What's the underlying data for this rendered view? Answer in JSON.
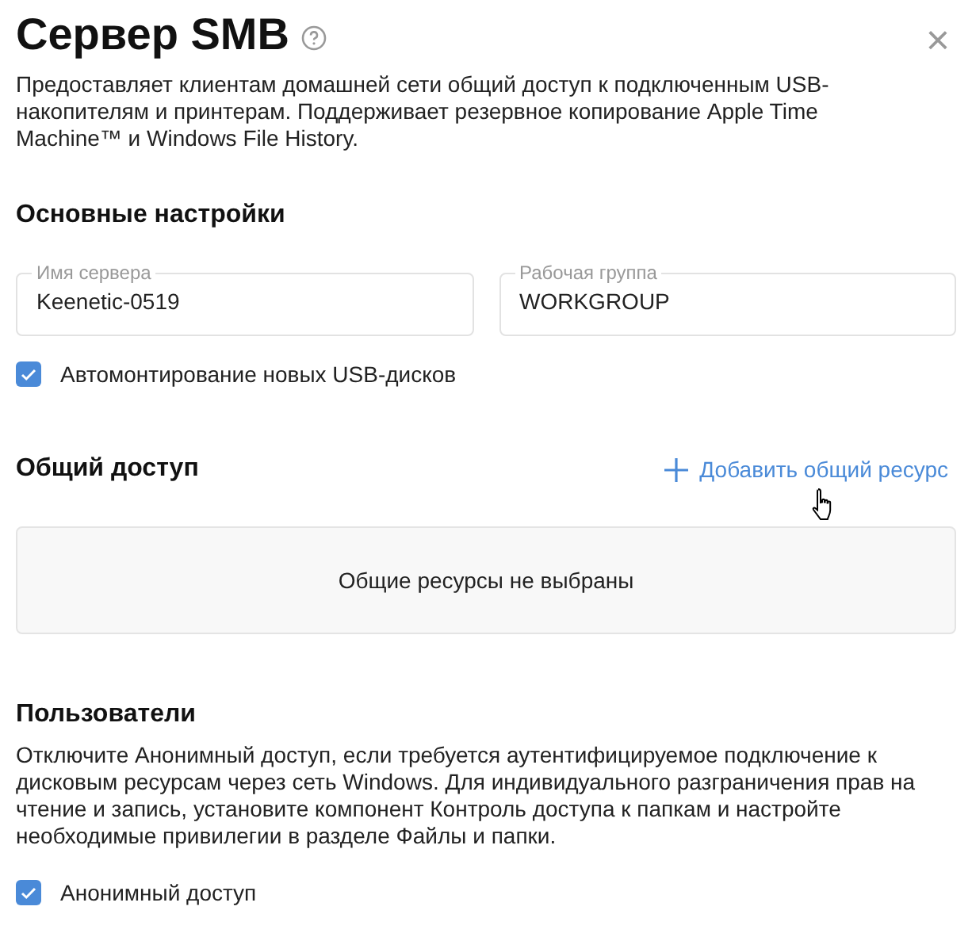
{
  "header": {
    "title": "Сервер SMB",
    "close": "×"
  },
  "description": "Предоставляет клиентам домашней сети общий доступ к подключенным USB-накопителям и принтерам. Поддерживает резервное копирование Apple Time Machine™ и Windows File History.",
  "basic_settings": {
    "heading": "Основные настройки",
    "fields": [
      {
        "label": "Имя сервера",
        "value": "Keenetic-0519"
      },
      {
        "label": "Рабочая группа",
        "value": "WORKGROUP"
      }
    ],
    "automount": {
      "label": "Автомонтирование новых USB-дисков",
      "checked": true
    }
  },
  "sharing": {
    "heading": "Общий доступ",
    "add_link": "Добавить общий ресурс",
    "empty_message": "Общие ресурсы не выбраны"
  },
  "users": {
    "heading": "Пользователи",
    "description": "Отключите Анонимный доступ, если требуется аутентифицируемое подключение к дисковым ресурсам через сеть Windows. Для индивидуального разграничения прав на чтение и запись, установите компонент Контроль доступа к папкам и настройте необходимые привилегии в разделе Файлы и папки.",
    "anonymous": {
      "label": "Анонимный доступ",
      "checked": true
    }
  }
}
